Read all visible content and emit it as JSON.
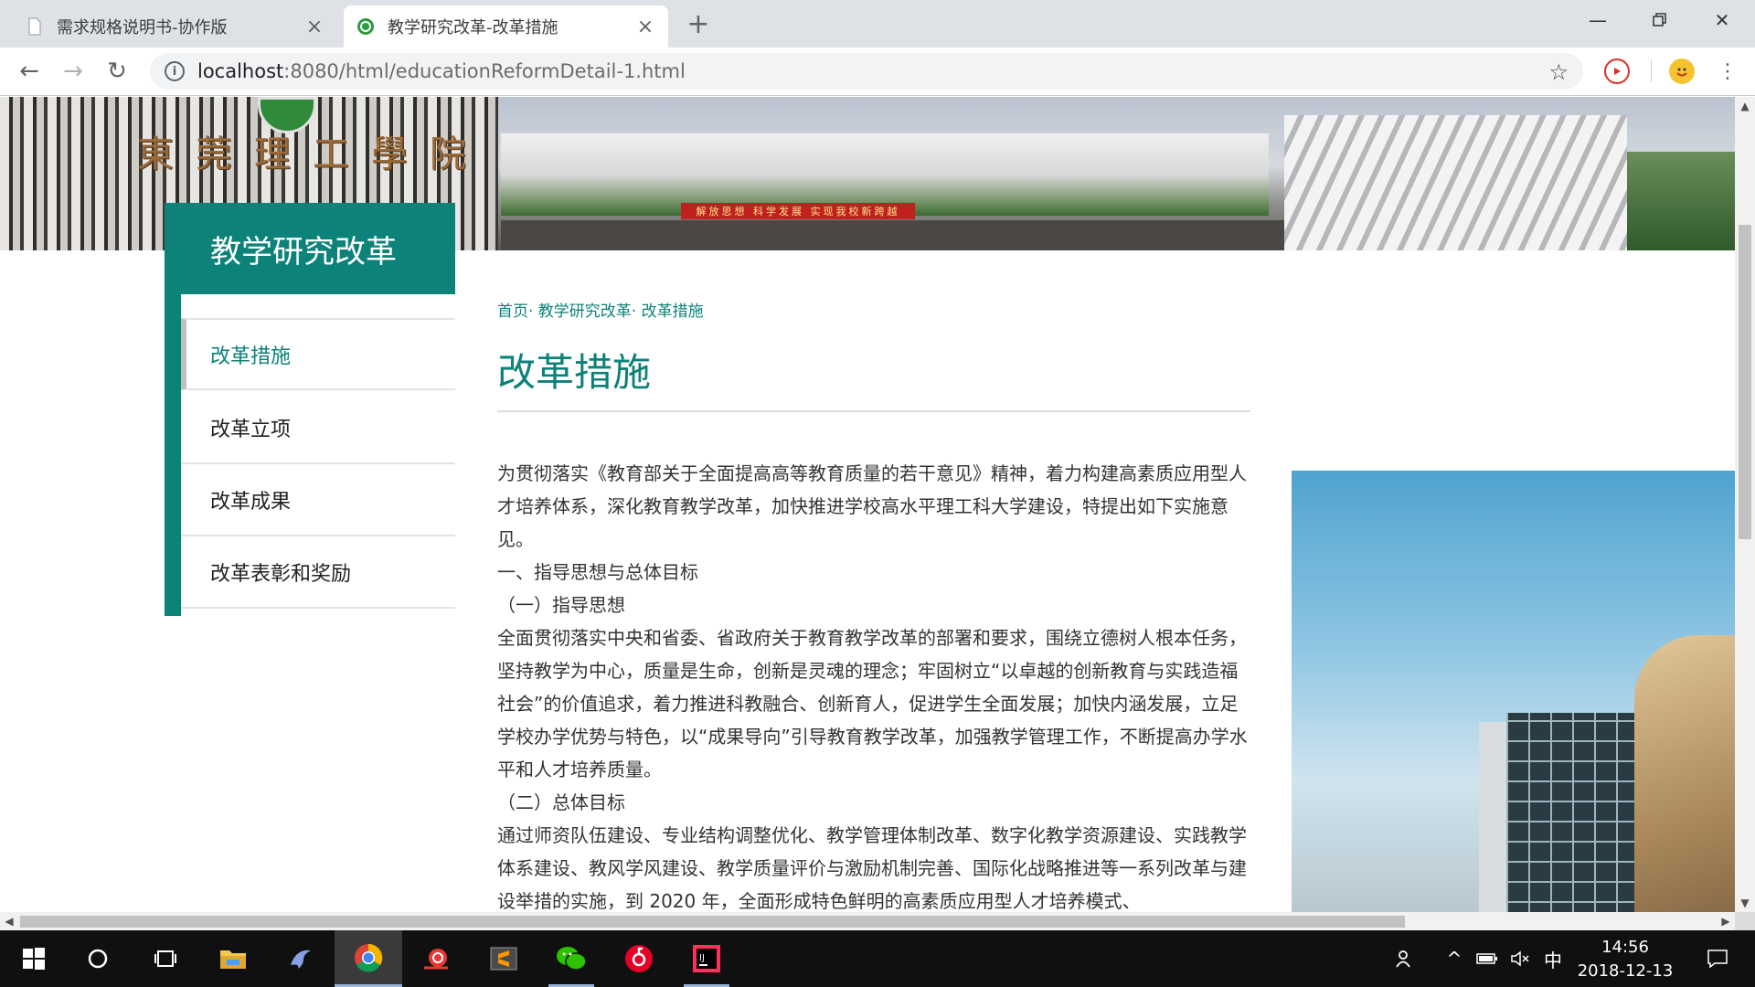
{
  "browser": {
    "tabs": [
      {
        "title": "需求规格说明书-协作版",
        "active": false
      },
      {
        "title": "教学研究改革-改革措施",
        "active": true
      }
    ],
    "new_tab_icon": "plus-icon",
    "address": {
      "host": "localhost",
      "path": ":8080/html/educationReformDetail-1.html"
    }
  },
  "site": {
    "banner_sign": "東莞理工學院",
    "banner_slogan": "解放思想 科学发展 实现我校新跨越",
    "sidebar_title": "教学研究改革",
    "sidebar_items": [
      "改革措施",
      "改革立项",
      "改革成果",
      "改革表彰和奖励"
    ],
    "active_index": 0
  },
  "content": {
    "breadcrumb": "首页· 教学研究改革· 改革措施",
    "title": "改革措施",
    "paragraphs": [
      "为贯彻落实《教育部关于全面提高高等教育质量的若干意见》精神，着力构建高素质应用型人才培养体系，深化教育教学改革，加快推进学校高水平理工科大学建设，特提出如下实施意见。",
      "一、指导思想与总体目标",
      "（一）指导思想",
      "全面贯彻落实中央和省委、省政府关于教育教学改革的部署和要求，围绕立德树人根本任务，坚持教学为中心，质量是生命，创新是灵魂的理念；牢固树立“以卓越的创新教育与实践造福社会”的价值追求，着力推进科教融合、创新育人，促进学生全面发展；加快内涵发展，立足学校办学优势与特色，以“成果导向”引导教育教学改革，加强教学管理工作，不断提高办学水平和人才培养质量。",
      "（二）总体目标",
      "通过师资队伍建设、专业结构调整优化、教学管理体制改革、数字化教学资源建设、实践教学体系建设、教风学风建设、教学质量评价与激励机制完善、国际化战略推进等一系列改革与建设举措的实施，到 2020 年，全面形成特色鲜明的高素质应用型人才培养模式、"
    ]
  },
  "taskbar": {
    "clock_time": "14:56",
    "clock_date": "2018-12-13",
    "ime": "中",
    "apps": [
      "start-icon",
      "cortana-icon",
      "task-view-icon",
      "file-explorer-icon",
      "dolphin-app-icon",
      "chrome-icon",
      "snail-app-icon",
      "sublime-icon",
      "wechat-icon",
      "netease-music-icon",
      "intellij-icon"
    ]
  },
  "colors": {
    "accent": "#0c8278",
    "tab_bg": "#dee1e6"
  }
}
